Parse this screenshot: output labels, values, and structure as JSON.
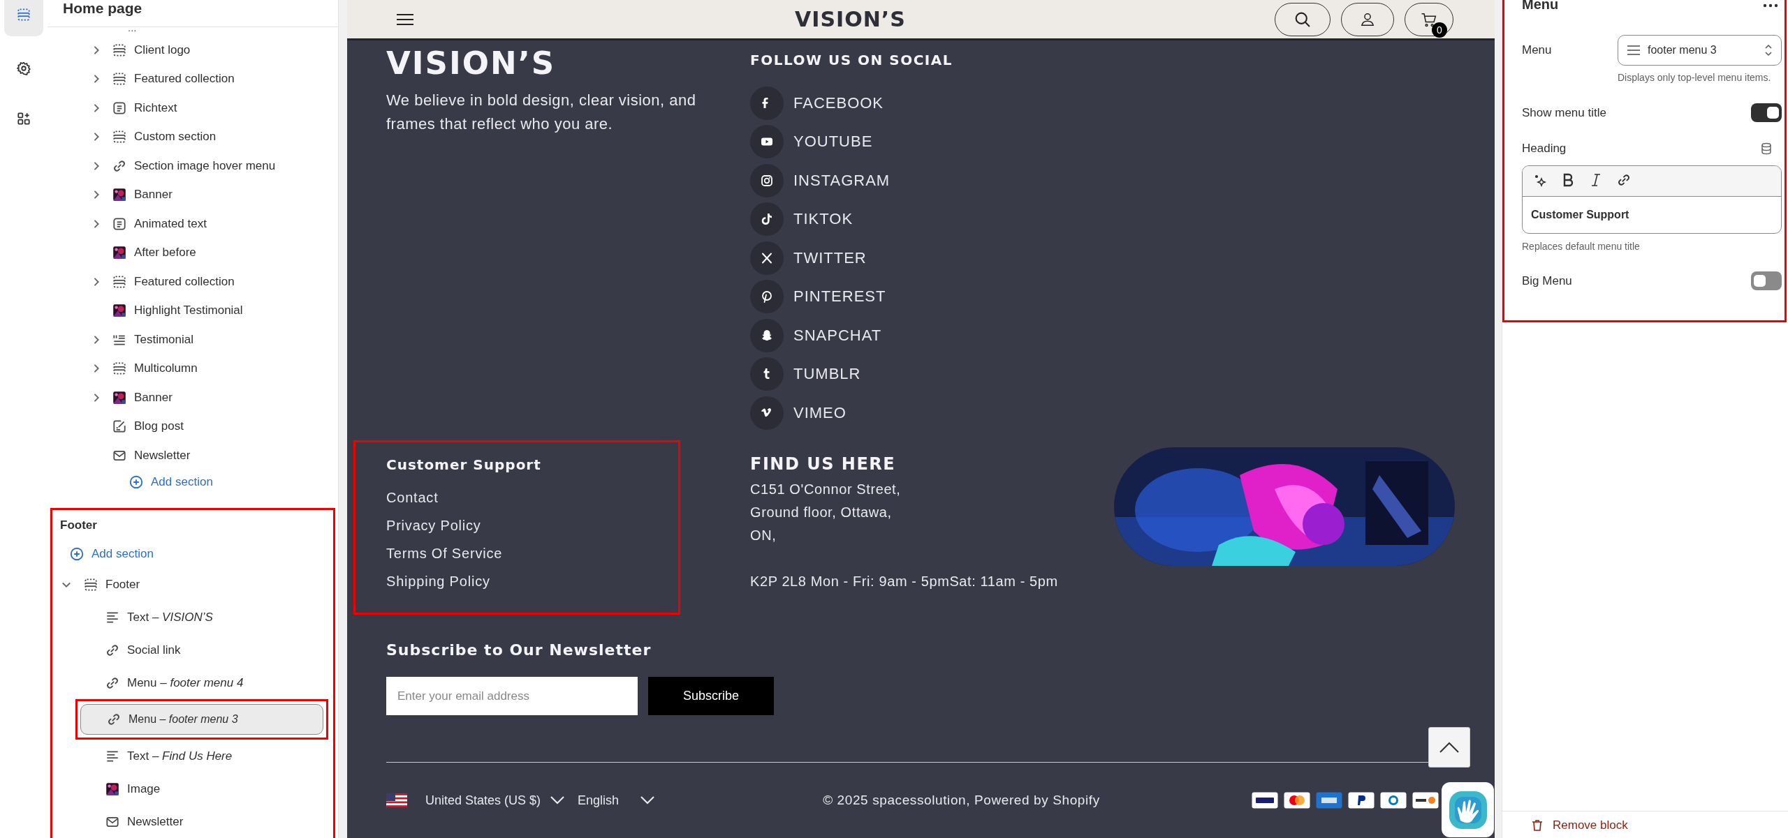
{
  "rail": [
    {
      "kind": "sections",
      "selected": true
    },
    {
      "kind": "settings",
      "selected": false
    },
    {
      "kind": "apps",
      "selected": false
    }
  ],
  "sidebar": {
    "title": "Home page",
    "ellipsis": "...",
    "sections": [
      {
        "label": "Client logo",
        "kind": "section",
        "expandable": true
      },
      {
        "label": "Featured collection",
        "kind": "section",
        "expandable": true
      },
      {
        "label": "Richtext",
        "kind": "text",
        "expandable": true
      },
      {
        "label": "Custom section",
        "kind": "section",
        "expandable": true
      },
      {
        "label": "Section image hover menu",
        "kind": "link",
        "expandable": true
      },
      {
        "label": "Banner",
        "kind": "picture",
        "expandable": true
      },
      {
        "label": "Animated text",
        "kind": "text",
        "expandable": true
      },
      {
        "label": "After before",
        "kind": "picture",
        "expandable": false
      },
      {
        "label": "Featured collection",
        "kind": "section",
        "expandable": true
      },
      {
        "label": "Highlight Testimonial",
        "kind": "picture",
        "expandable": false
      },
      {
        "label": "Testimonial",
        "kind": "testimonial",
        "expandable": true
      },
      {
        "label": "Multicolumn",
        "kind": "section",
        "expandable": true
      },
      {
        "label": "Banner",
        "kind": "picture",
        "expandable": true
      },
      {
        "label": "Blog post",
        "kind": "blog",
        "expandable": false
      },
      {
        "label": "Newsletter",
        "kind": "newsletter",
        "expandable": false
      }
    ],
    "add_section": "Add section",
    "footer": {
      "title": "Footer",
      "add_section": "Add section",
      "group": {
        "label": "Footer",
        "expanded": true,
        "children": [
          {
            "label": "Text – *VISION’S*",
            "kind": "lines",
            "selected": false
          },
          {
            "label": "Social link",
            "kind": "link",
            "selected": false
          },
          {
            "label": "Menu – *footer menu 4*",
            "kind": "link",
            "selected": false
          },
          {
            "label": "Menu – *footer menu 3*",
            "kind": "link",
            "selected": true
          },
          {
            "label": "Text – *Find Us Here*",
            "kind": "lines",
            "selected": false
          },
          {
            "label": "Image",
            "kind": "picture",
            "selected": false
          },
          {
            "label": "Newsletter",
            "kind": "newsletter",
            "selected": false
          }
        ]
      }
    }
  },
  "preview": {
    "header": {
      "brand": "VISION’S",
      "cart_count": "0"
    },
    "about": {
      "brand": "VISION’S",
      "text": "We believe in bold design, clear vision, and frames that reflect who you are."
    },
    "social": {
      "title": "FOLLOW US ON SOCIAL",
      "links": [
        {
          "kind": "facebook",
          "label": "FACEBOOK"
        },
        {
          "kind": "youtube",
          "label": "YOUTUBE"
        },
        {
          "kind": "instagram",
          "label": "INSTAGRAM"
        },
        {
          "kind": "tiktok",
          "label": "TIKTOK"
        },
        {
          "kind": "twitter",
          "label": "TWITTER"
        },
        {
          "kind": "pinterest",
          "label": "PINTEREST"
        },
        {
          "kind": "snapchat",
          "label": "SNAPCHAT"
        },
        {
          "kind": "tumblr",
          "label": "TUMBLR"
        },
        {
          "kind": "vimeo",
          "label": "VIMEO"
        }
      ]
    },
    "support": {
      "title": "Customer Support",
      "links": [
        "Contact",
        "Privacy Policy",
        "Terms Of Service",
        "Shipping Policy"
      ]
    },
    "find": {
      "title": "FIND US HERE",
      "lines": [
        "C151 O'Connor Street,",
        "Ground floor, Ottawa,",
        "ON,"
      ],
      "hours": "K2P 2L8 Mon - Fri: 9am - 5pmSat: 11am - 5pm"
    },
    "newsletter": {
      "title": "Subscribe to Our Newsletter",
      "placeholder": "Enter your email address",
      "button": "Subscribe"
    },
    "bottom": {
      "country": "United States (US $)",
      "language": "English",
      "copyright": "© 2025 spacessolution, Powered by Shopify",
      "payments": [
        {
          "kind": "visa"
        },
        {
          "kind": "mastercard"
        },
        {
          "kind": "amex"
        },
        {
          "kind": "paypal"
        },
        {
          "kind": "diners"
        },
        {
          "kind": "discover"
        }
      ]
    }
  },
  "panel": {
    "title": "Menu",
    "menu_label": "Menu",
    "menu_value": "footer menu 3",
    "menu_help": "Displays only top-level menu items.",
    "show_title": {
      "label": "Show menu title",
      "on": true
    },
    "heading": {
      "label": "Heading",
      "value": "Customer Support",
      "help": "Replaces default menu title"
    },
    "big_menu": {
      "label": "Big Menu",
      "on": false
    },
    "remove": "Remove block"
  }
}
